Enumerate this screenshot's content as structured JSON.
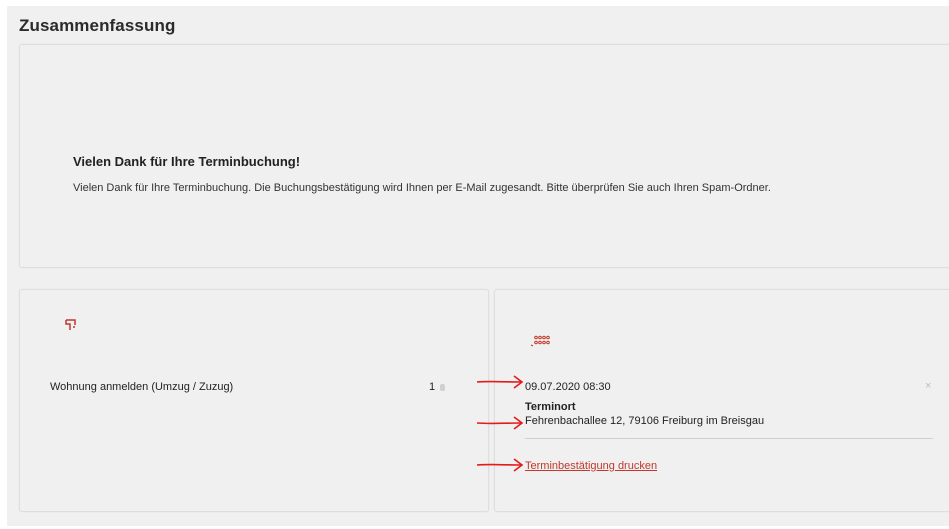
{
  "summary": {
    "title": "Zusammenfassung"
  },
  "confirmation": {
    "heading": "Vielen Dank für Ihre Terminbuchung!",
    "message": "Vielen Dank für Ihre Terminbuchung. Die Buchungsbestätigung wird Ihnen per E-Mail zugesandt. Bitte überprüfen Sie auch Ihren Spam-Ordner."
  },
  "services": {
    "icon": "services-icon",
    "items": [
      {
        "label": "Wohnung anmelden (Umzug / Zuzug)",
        "quantity": "1"
      }
    ]
  },
  "appointment": {
    "icon": "calendar-dots-icon",
    "datetime": "09.07.2020 08:30",
    "close_symbol": "×",
    "location_heading": "Terminort",
    "location_address": "Fehrenbachallee 12, 79106 Freiburg im Breisgau",
    "print_link": "Terminbestätigung drucken"
  },
  "colors": {
    "accent": "#c0392b",
    "annotation_arrow": "#e31b1b",
    "background": "#f0f0f0"
  }
}
